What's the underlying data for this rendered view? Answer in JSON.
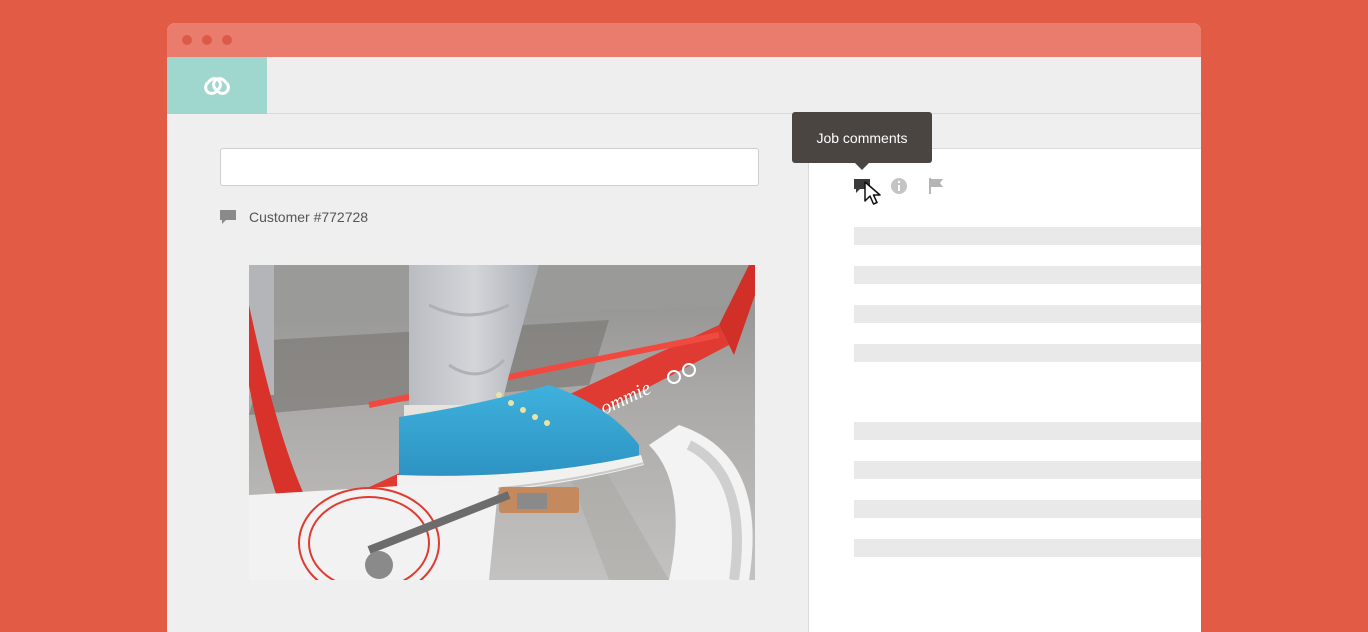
{
  "window": {
    "controls": [
      "close-dot",
      "minimize-dot",
      "maximize-dot"
    ]
  },
  "header": {
    "logo_icon": "knot-logo-icon",
    "logo_color": "#9fd6cd"
  },
  "search": {
    "value": "",
    "placeholder": ""
  },
  "customer": {
    "icon": "comment-icon",
    "label": "Customer #772728"
  },
  "photo": {
    "description_icon": "job-photo"
  },
  "panel": {
    "icons": [
      "comment-icon",
      "info-icon",
      "flag-icon"
    ],
    "tooltip": "Job comments"
  },
  "colors": {
    "background": "#e25c45",
    "titlebar": "#ea7c6e",
    "accent": "#9fd6cd",
    "tooltip": "#4a4541"
  }
}
